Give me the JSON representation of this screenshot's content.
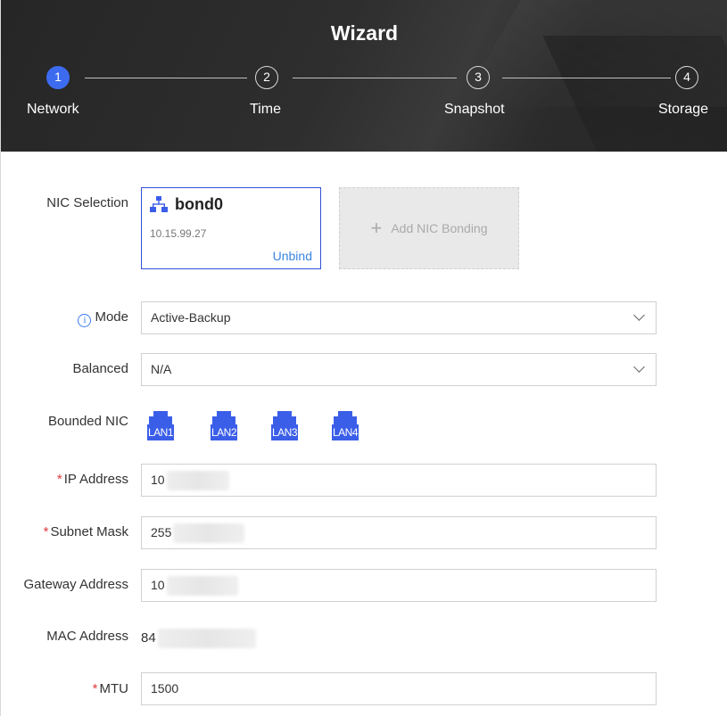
{
  "header": {
    "title": "Wizard",
    "steps": [
      {
        "number": "1",
        "label": "Network",
        "active": true
      },
      {
        "number": "2",
        "label": "Time",
        "active": false
      },
      {
        "number": "3",
        "label": "Snapshot",
        "active": false
      },
      {
        "number": "4",
        "label": "Storage",
        "active": false
      }
    ]
  },
  "form": {
    "nic_selection": {
      "label": "NIC Selection",
      "card": {
        "icon": "network-icon",
        "name": "bond0",
        "ip": "10.15.99.27",
        "unbind": "Unbind"
      },
      "add_bonding": {
        "icon": "plus-icon",
        "label": "Add NIC Bonding"
      }
    },
    "mode": {
      "label": "Mode",
      "value": "Active-Backup"
    },
    "balanced": {
      "label": "Balanced",
      "value": "N/A"
    },
    "bounded_nic": {
      "label": "Bounded NIC",
      "ports": [
        "LAN1",
        "LAN2",
        "LAN3",
        "LAN4"
      ]
    },
    "ip_address": {
      "label": "IP Address",
      "required": "*",
      "value": "10"
    },
    "subnet_mask": {
      "label": "Subnet Mask",
      "required": "*",
      "value": "255"
    },
    "gateway_address": {
      "label": "Gateway Address",
      "value": "10"
    },
    "mac_address": {
      "label": "MAC Address",
      "value": "84"
    },
    "mtu": {
      "label": "MTU",
      "required": "*",
      "value": "1500"
    }
  },
  "colors": {
    "accent": "#3d6bf0",
    "link": "#3a86e0",
    "required": "#e0393e",
    "port": "#3b5ee8"
  }
}
